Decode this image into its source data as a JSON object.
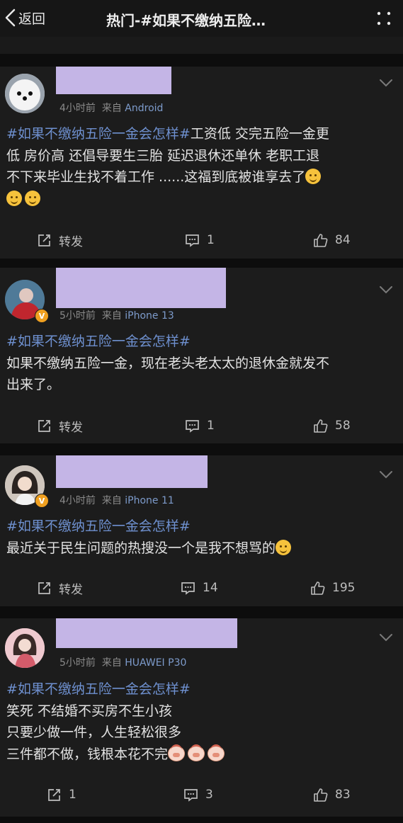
{
  "header": {
    "back_label": "返回",
    "title": "热门-#如果不缴纳五险…"
  },
  "posts": [
    {
      "time": "4小时前",
      "from": "来自",
      "source": "Android",
      "verified": false,
      "hashtag": "#如果不缴纳五险一金会怎样#",
      "lines": [
        "工资低  交完五险一金更",
        "低  房价高 还倡导要生三胎  延迟退休还单休  老职工退",
        "不下来毕业生找不着工作 ......这福到底被谁享去了"
      ],
      "repost_label": "转发",
      "comments": "1",
      "likes": "84"
    },
    {
      "time": "5小时前",
      "from": "来自",
      "source": "iPhone 13",
      "verified": true,
      "badge": "V",
      "hashtag": "#如果不缴纳五险一金会怎样#",
      "lines": [
        "如果不缴纳五险一金，现在老头老太太的退休金就发不",
        "出来了。"
      ],
      "repost_label": "转发",
      "comments": "1",
      "likes": "58"
    },
    {
      "time": "4小时前",
      "from": "来自",
      "source": "iPhone 11",
      "verified": true,
      "badge": "V",
      "hashtag": "#如果不缴纳五险一金会怎样#",
      "lines": [
        "最近关于民生问题的热搜没一个是我不想骂的"
      ],
      "repost_label": "转发",
      "comments": "14",
      "likes": "195"
    },
    {
      "time": "5小时前",
      "from": "来自",
      "source": "HUAWEI P30",
      "verified": false,
      "hashtag": "#如果不缴纳五险一金会怎样#",
      "lines": [
        "笑死 不结婚不买房不生小孩",
        "只要少做一件，人生轻松很多",
        "三件都不做，钱根本花不完"
      ],
      "repost_label": "1",
      "comments": "3",
      "likes": "83"
    }
  ],
  "colors": {
    "hashtag": "#6e90cf",
    "source": "#7d9bcb",
    "name_placeholder": "#c4b5e6",
    "card_bg": "#1c1c1c",
    "page_bg": "#0d0d0d"
  }
}
